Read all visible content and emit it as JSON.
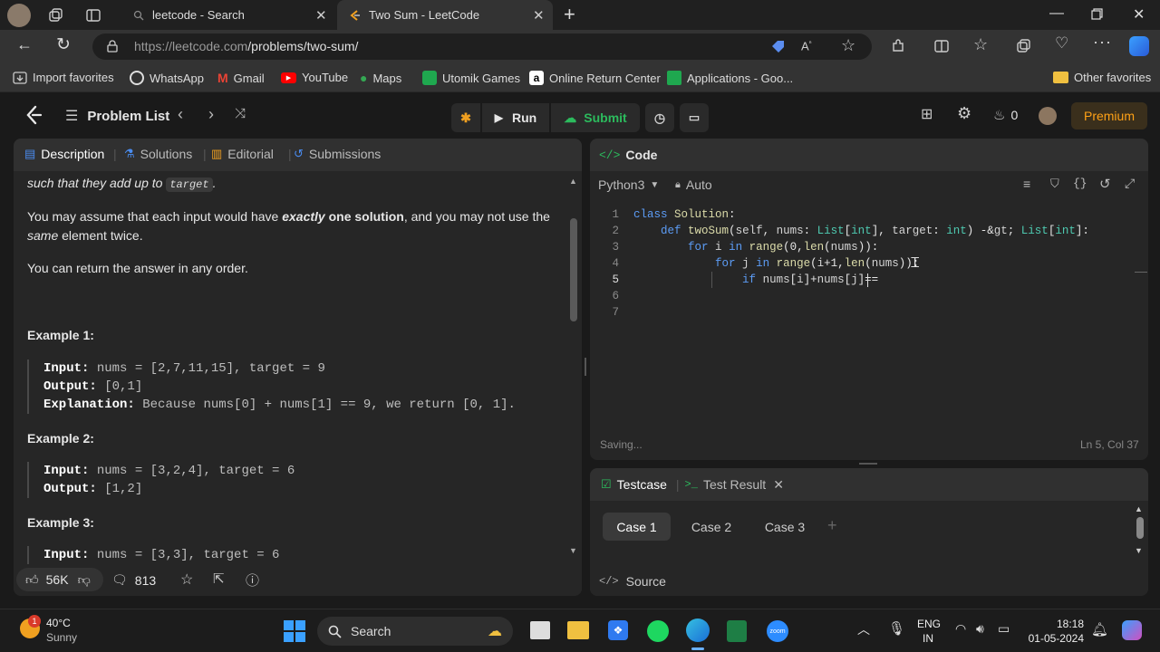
{
  "browser": {
    "tabs": [
      {
        "label": "leetcode - Search"
      },
      {
        "label": "Two Sum - LeetCode"
      }
    ],
    "url_host": "https://leetcode.com",
    "url_path": "/problems/two-sum/",
    "bookmarks": [
      "Import favorites",
      "WhatsApp",
      "Gmail",
      "YouTube",
      "Maps",
      "Utomik Games",
      "Online Return Center",
      "Applications - Goo...",
      "Other favorites"
    ]
  },
  "lc": {
    "problem_list": "Problem List",
    "run": "Run",
    "submit": "Submit",
    "streak": "0",
    "premium": "Premium"
  },
  "left": {
    "tabs": [
      "Description",
      "Solutions",
      "Editorial",
      "Submissions"
    ],
    "line1_pre": "such that they add up to",
    "line1_code": "target",
    "line1_post": ".",
    "p2_a": "You may assume that each input would have",
    "p2_b": "exactly",
    "p2_c": "one solution",
    "p2_d": ", and you may not use the",
    "p2_e": "same",
    "p2_f": "element twice.",
    "p3": "You can return the answer in any order.",
    "examples": [
      {
        "title": "Example 1:",
        "input_label": "Input:",
        "input": "nums = [2,7,11,15], target = 9",
        "output_label": "Output:",
        "output": "[0,1]",
        "expl_label": "Explanation:",
        "expl": "Because nums[0] + nums[1] == 9, we return [0, 1]."
      },
      {
        "title": "Example 2:",
        "input_label": "Input:",
        "input": "nums = [3,2,4], target = 6",
        "output_label": "Output:",
        "output": "[1,2]"
      },
      {
        "title": "Example 3:",
        "input_label": "Input:",
        "input": "nums = [3,3], target = 6"
      }
    ],
    "likes": "56K",
    "comments": "813"
  },
  "code": {
    "title": "Code",
    "language": "Python3",
    "auto": "Auto",
    "lines": [
      {
        "n": "1",
        "text": "class Solution:"
      },
      {
        "n": "2",
        "text": "    def twoSum(self, nums: List[int], target: int) -> List[int]:"
      },
      {
        "n": "3",
        "text": "        for i in range(0,len(nums)):"
      },
      {
        "n": "4",
        "text": "            for j in range(i+1,len(nums)):"
      },
      {
        "n": "5",
        "text": "                if nums[i]+nums[j]=="
      },
      {
        "n": "6",
        "text": ""
      },
      {
        "n": "7",
        "text": ""
      }
    ],
    "status": "Saving...",
    "position": "Ln 5, Col 37"
  },
  "testcase": {
    "tab1": "Testcase",
    "tab2": "Test Result",
    "cases": [
      "Case 1",
      "Case 2",
      "Case 3"
    ],
    "source": "Source"
  },
  "taskbar": {
    "temp": "40°C",
    "weather": "Sunny",
    "search": "Search",
    "lang1": "ENG",
    "lang2": "IN",
    "time": "18:18",
    "date": "01-05-2024"
  }
}
